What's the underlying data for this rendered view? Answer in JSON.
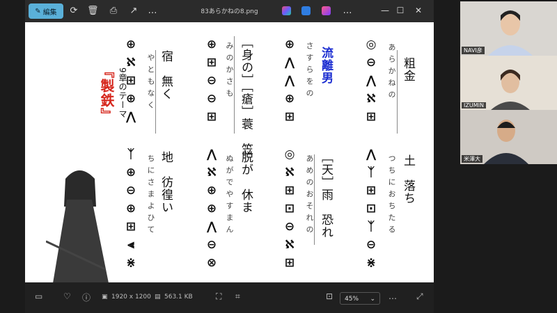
{
  "window": {
    "filename": "83あらかねの8.png",
    "edit_label": "編集"
  },
  "slide": {
    "chapter": "9章のテーマ",
    "theme": "『製鉄』",
    "columns": [
      {
        "id": "c1",
        "kanji_top": "粗金",
        "kana_top": "あらかねの",
        "kanji_bottom": "土　落ち",
        "kana_bottom": "つちにおちたる"
      },
      {
        "id": "c2",
        "kanji_top": "流離男",
        "kana_top": "さすらをの",
        "kanji_bottom": "［天］雨　恐れ",
        "kana_bottom": "あめのおそれの"
      },
      {
        "id": "c3",
        "kanji_top": "［身の］［瘡］蓑　笠",
        "kana_top": "みのかさも",
        "kanji_bottom": "脱が　休ま",
        "kana_bottom": "ぬがでやすまん"
      },
      {
        "id": "c4",
        "kanji_top": "宿　無く",
        "kana_top": "やともなく",
        "kanji_bottom": "地　彷徨い",
        "kana_bottom": "ちにさまよひて"
      }
    ]
  },
  "statusbar": {
    "resolution": "1920 x 1200",
    "filesize": "563.1 KB",
    "zoom": "45%"
  },
  "participants": [
    {
      "name": "NAVI彦"
    },
    {
      "name": "IZUMIN"
    },
    {
      "name": "米澤大"
    }
  ],
  "colors": {
    "accent": "#5ab0d9",
    "theme_red": "#d6281e",
    "theme_blue": "#1d2fd1"
  }
}
